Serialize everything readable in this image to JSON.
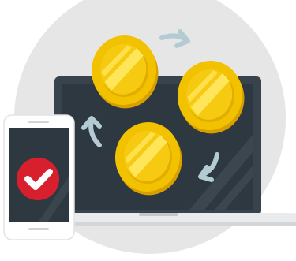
{
  "illustration": {
    "subject": "coins-exchange-laptop-phone",
    "elements": {
      "background_circle": "circle-shape",
      "laptop": "laptop-icon",
      "phone": "phone-icon",
      "check_badge": "checkmark-icon",
      "coins": [
        "coin-icon",
        "coin-icon",
        "coin-icon"
      ],
      "arrows": [
        "refresh-arrow-icon",
        "refresh-arrow-icon",
        "refresh-arrow-icon"
      ]
    }
  },
  "colors": {
    "background_circle": "#E6E6E6",
    "laptop_frame": "#39434B",
    "laptop_screen": "#2E3840",
    "laptop_base": "#E9EBED",
    "phone_body": "#FFFFFF",
    "phone_screen": "#2E3840",
    "check_red": "#D81F2D",
    "coin_gold": "#F2C200",
    "coin_dark": "#D89F00",
    "coin_light": "#FFE55A",
    "arrow": "#B4CBD4"
  }
}
